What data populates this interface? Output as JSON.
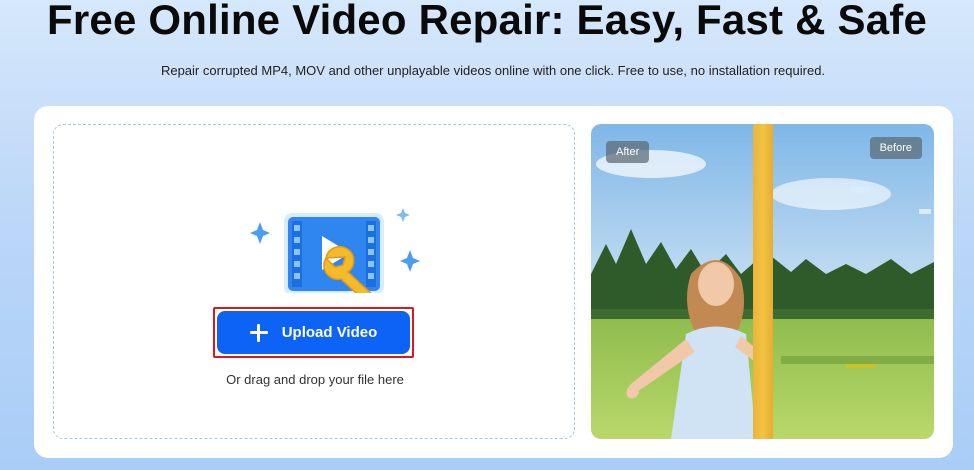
{
  "header": {
    "title": "Free Online Video Repair: Easy, Fast & Safe",
    "subtitle": "Repair corrupted MP4, MOV and other unplayable videos online with one click. Free to use, no installation required."
  },
  "upload": {
    "button_label": "Upload Video",
    "drag_hint": "Or drag and drop your file here",
    "icon": "video-repair-wrench-icon"
  },
  "preview": {
    "after_label": "After",
    "before_label": "Before"
  },
  "colors": {
    "accent": "#0c63f5",
    "highlight_border": "#d8191f",
    "divider": "#f3c343"
  }
}
